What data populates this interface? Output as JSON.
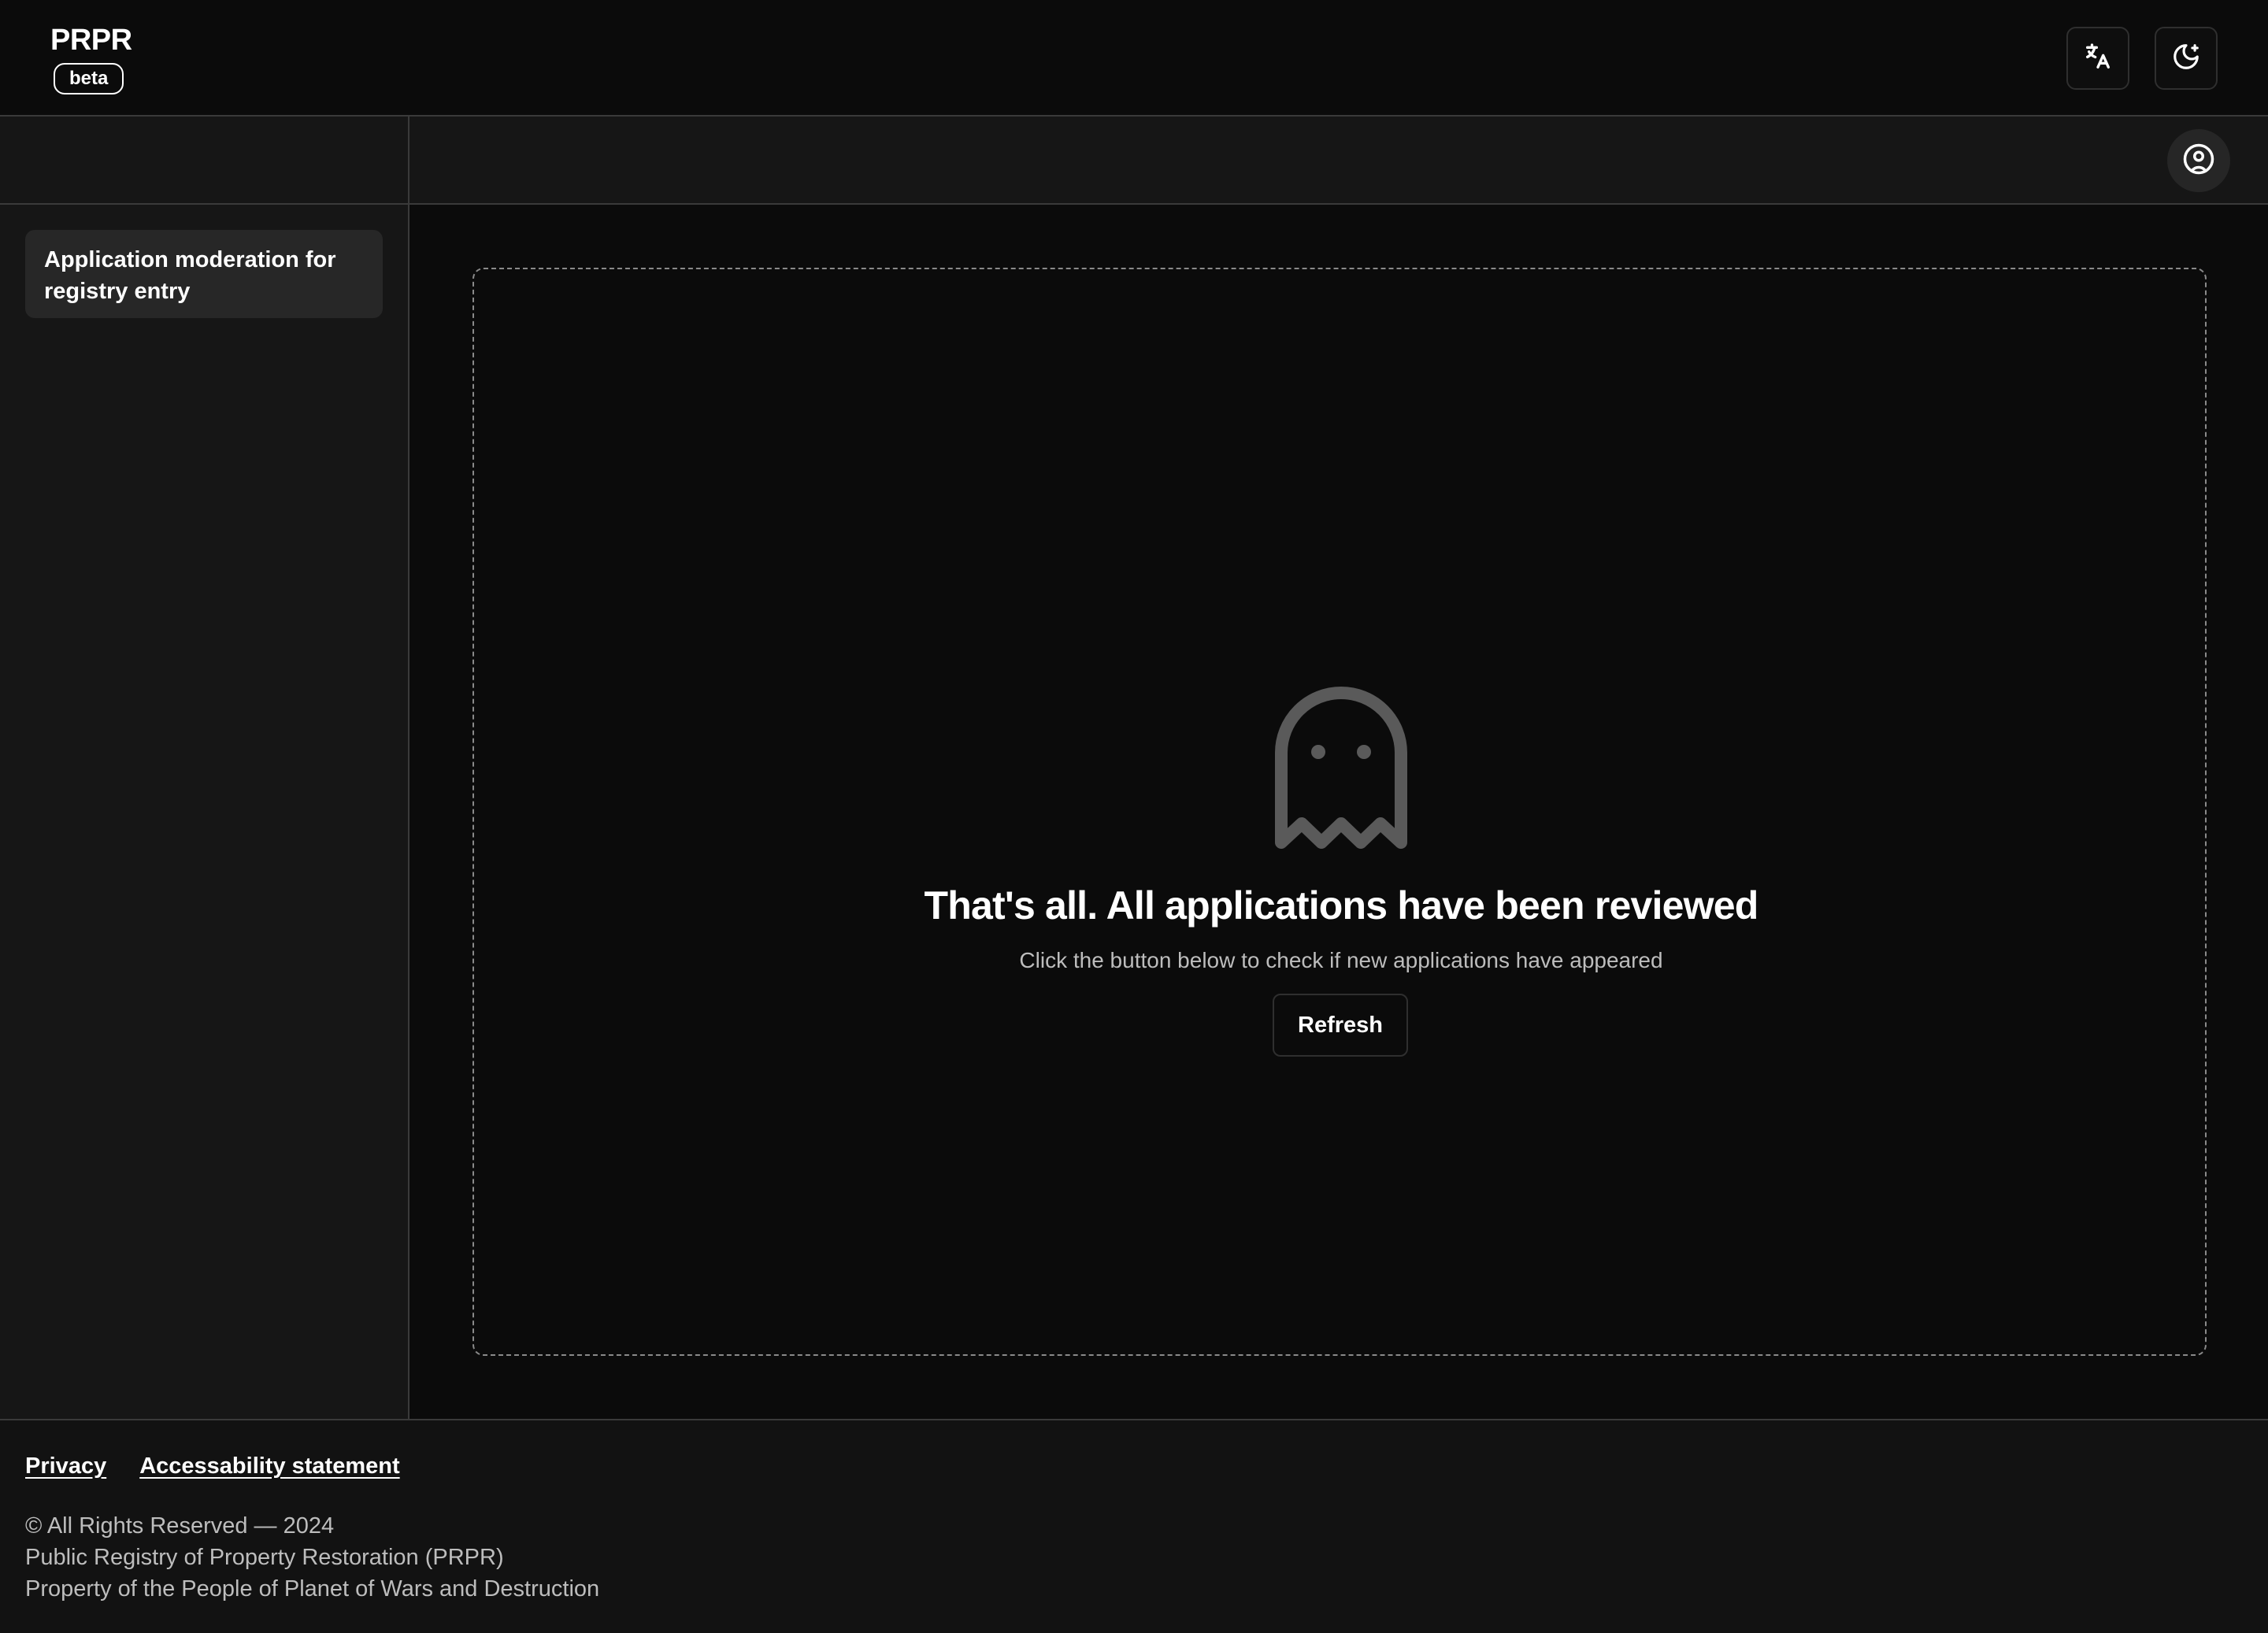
{
  "header": {
    "brand": "PRPR",
    "badge": "beta",
    "translate_icon": "translate-icon",
    "theme_icon": "moon-star-icon"
  },
  "subheader": {
    "profile_icon": "user-circle-icon"
  },
  "sidebar": {
    "items": [
      {
        "label": "Application moderation for registry entry",
        "active": true
      }
    ]
  },
  "main": {
    "empty_state": {
      "icon": "ghost-icon",
      "title": "That's all. All applications have been reviewed",
      "subtitle": "Click the button below to check if new applications have appeared",
      "button_label": "Refresh"
    }
  },
  "footer": {
    "links": [
      "Privacy",
      "Accessability statement"
    ],
    "lines": [
      "© All Rights Reserved — 2024",
      "Public Registry of Property Restoration (PRPR)",
      "Property of the People of Planet of Wars and Destruction"
    ]
  },
  "colors": {
    "background": "#0b0b0b",
    "panel": "#161616",
    "sidebar_item_active": "#272727",
    "border": "#3a3a3a",
    "muted_text": "#bdbdbd",
    "ghost": "#5a5a5a"
  }
}
